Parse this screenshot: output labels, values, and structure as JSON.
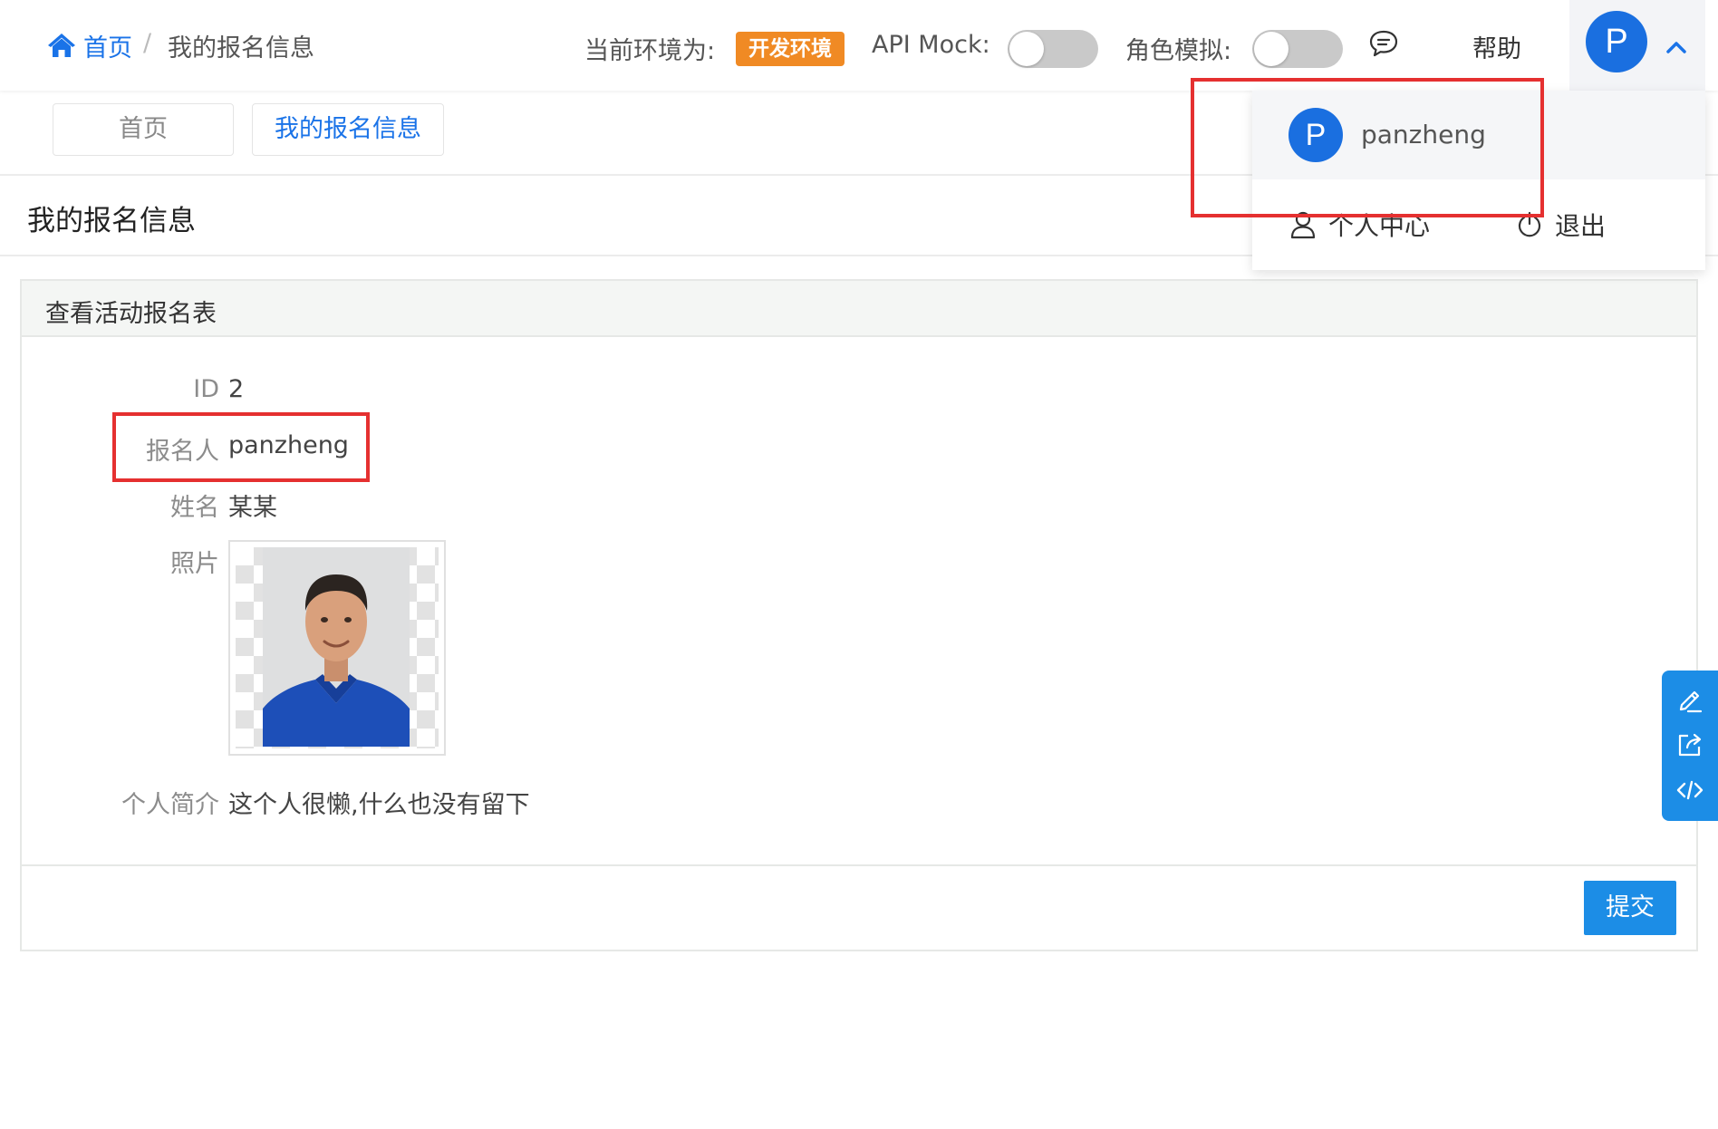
{
  "header": {
    "breadcrumb_home": "首页",
    "breadcrumb_sep": "/",
    "breadcrumb_current": "我的报名信息",
    "env_label": "当前环境为:",
    "env_badge": "开发环境",
    "api_mock_label": "API Mock:",
    "api_mock_on": false,
    "role_sim_label": "角色模拟:",
    "role_sim_on": false,
    "help_label": "帮助",
    "avatar_letter": "P",
    "icons": {
      "home": "home-icon",
      "message": "chat-icon",
      "chevron": "chevron-up-icon"
    }
  },
  "user_dropdown": {
    "avatar_letter": "P",
    "username": "panzheng",
    "profile_label": "个人中心",
    "logout_label": "退出"
  },
  "tabs": [
    {
      "label": "首页",
      "active": false
    },
    {
      "label": "我的报名信息",
      "active": true
    }
  ],
  "page_title": "我的报名信息",
  "form": {
    "title": "查看活动报名表",
    "fields": [
      {
        "label": "ID",
        "value": "2"
      },
      {
        "label": "报名人",
        "value": "panzheng"
      },
      {
        "label": "姓名",
        "value": "某某"
      },
      {
        "label": "照片",
        "value": ""
      },
      {
        "label": "个人简介",
        "value": "这个人很懒,什么也没有留下"
      }
    ],
    "submit_label": "提交"
  },
  "side_tools": [
    "edit-icon",
    "share-icon",
    "code-icon"
  ],
  "colors": {
    "primary": "#1a73e8",
    "env_badge": "#f08a24",
    "button": "#1c8de6",
    "highlight": "#e53030"
  }
}
